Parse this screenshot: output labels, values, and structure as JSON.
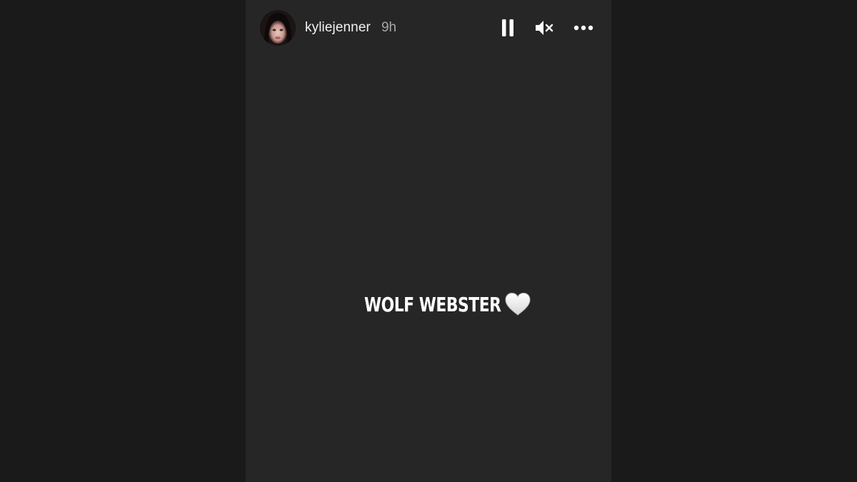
{
  "story": {
    "username": "kyliejenner",
    "timestamp": "9h",
    "caption": "WOLF WEBSTER",
    "caption_emoji": "white-heart-icon",
    "background_color": "#262626"
  },
  "controls": {
    "pause": "pause-icon",
    "mute": "speaker-muted-icon",
    "more": "more-options-icon"
  }
}
